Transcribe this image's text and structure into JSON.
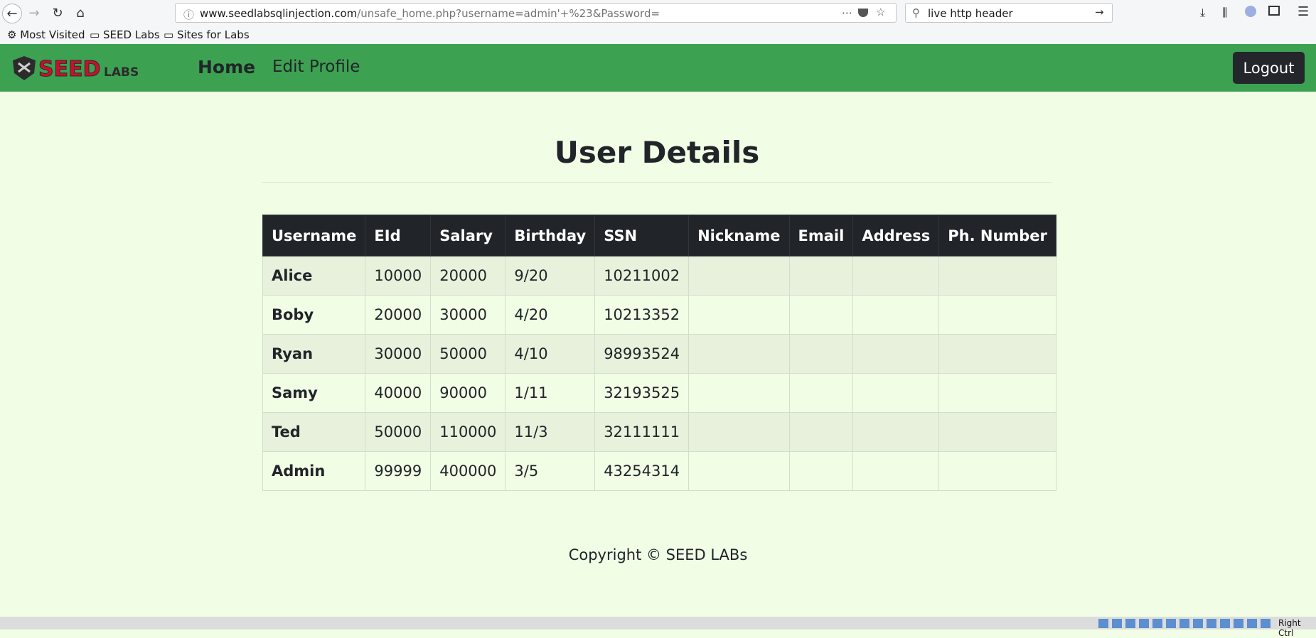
{
  "browser": {
    "url_domain": "www.seedlabsqlinjection.com",
    "url_path": "/unsafe_home.php?username=admin'+%23&Password=",
    "search_value": "live http header",
    "bookmarks": [
      "Most Visited",
      "SEED Labs",
      "Sites for Labs"
    ]
  },
  "nav": {
    "home": "Home",
    "edit_profile": "Edit Profile",
    "logout": "Logout"
  },
  "logo": {
    "text_seed": "SEED",
    "text_labs": "LABS"
  },
  "page": {
    "title": "User Details",
    "footer": "Copyright © SEED LABs"
  },
  "table": {
    "headers": [
      "Username",
      "EId",
      "Salary",
      "Birthday",
      "SSN",
      "Nickname",
      "Email",
      "Address",
      "Ph. Number"
    ],
    "rows": [
      [
        "Alice",
        "10000",
        "20000",
        "9/20",
        "10211002",
        "",
        "",
        "",
        ""
      ],
      [
        "Boby",
        "20000",
        "30000",
        "4/20",
        "10213352",
        "",
        "",
        "",
        ""
      ],
      [
        "Ryan",
        "30000",
        "50000",
        "4/10",
        "98993524",
        "",
        "",
        "",
        ""
      ],
      [
        "Samy",
        "40000",
        "90000",
        "1/11",
        "32193525",
        "",
        "",
        "",
        ""
      ],
      [
        "Ted",
        "50000",
        "110000",
        "11/3",
        "32111111",
        "",
        "",
        "",
        ""
      ],
      [
        "Admin",
        "99999",
        "400000",
        "3/5",
        "43254314",
        "",
        "",
        "",
        ""
      ]
    ]
  },
  "statusbar": {
    "host_key": "Right Ctrl"
  },
  "colors": {
    "navbar": "#3da152",
    "page_bg": "#f2fde6",
    "table_header": "#212529",
    "logo_red": "#c8102e"
  }
}
